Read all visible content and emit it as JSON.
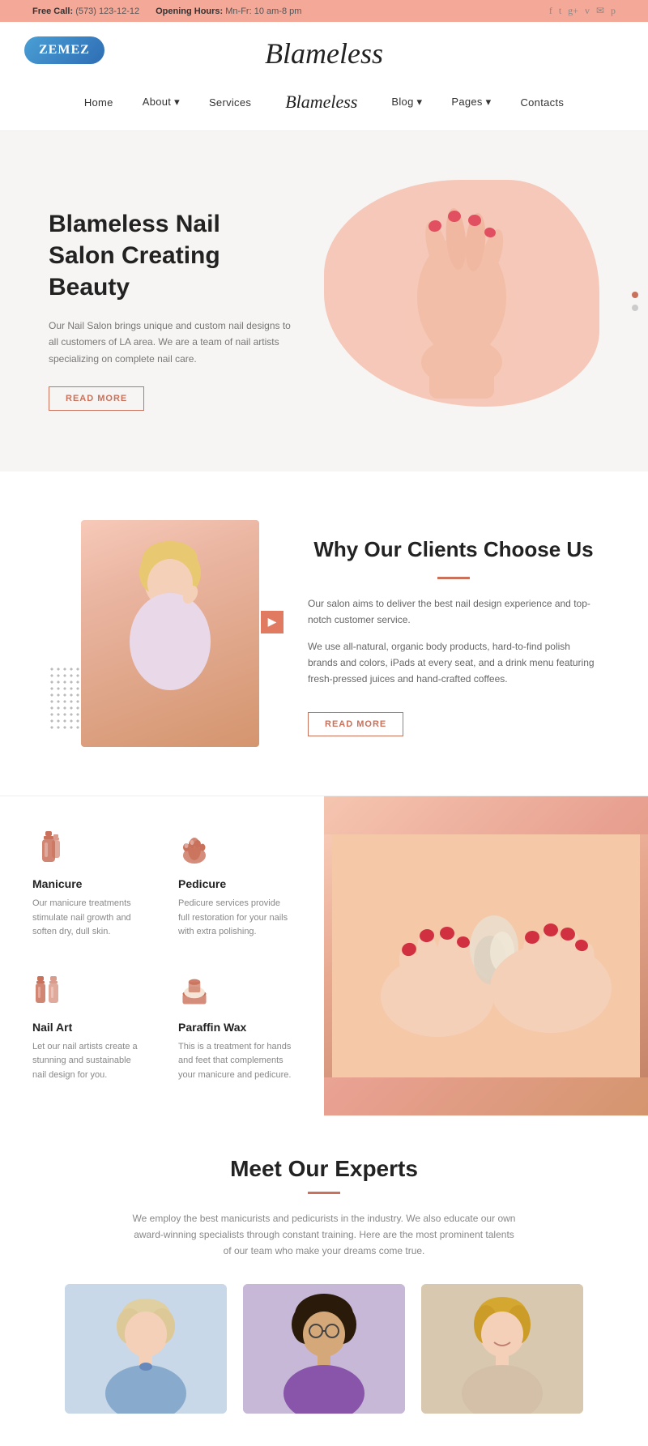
{
  "brand": {
    "zemez": "ZEMEZ",
    "name": "Blameless",
    "logo": "Blameless"
  },
  "topbar": {
    "free_call_label": "Free Call:",
    "free_call_number": "(573) 123-12-12",
    "opening_hours_label": "Opening Hours:",
    "opening_hours_value": "Mn-Fr: 10 am-8 pm"
  },
  "nav": {
    "items": [
      {
        "label": "Home",
        "has_dropdown": false
      },
      {
        "label": "About",
        "has_dropdown": true
      },
      {
        "label": "Services",
        "has_dropdown": false
      },
      {
        "label": "Blog",
        "has_dropdown": true
      },
      {
        "label": "Pages",
        "has_dropdown": true
      },
      {
        "label": "Contacts",
        "has_dropdown": false
      }
    ]
  },
  "hero": {
    "title": "Blameless Nail Salon Creating Beauty",
    "description": "Our Nail Salon brings unique and custom nail designs to all customers of LA area. We are a team of nail artists specializing on complete nail care.",
    "cta": "READ MORE",
    "dots": [
      "active",
      "inactive"
    ]
  },
  "why": {
    "title": "Why Our Clients Choose Us",
    "paragraph1": "Our salon aims to deliver the best nail design experience and top-notch customer service.",
    "paragraph2": "We use all-natural, organic body products, hard-to-find polish brands and colors, iPads at every seat, and a drink menu featuring fresh-pressed juices and hand-crafted coffees.",
    "cta": "READ MORE"
  },
  "services": {
    "items": [
      {
        "title": "Manicure",
        "description": "Our manicure treatments stimulate nail growth and soften dry, dull skin.",
        "icon": "manicure-icon"
      },
      {
        "title": "Pedicure",
        "description": "Pedicure services provide full restoration for your nails with extra polishing.",
        "icon": "pedicure-icon"
      },
      {
        "title": "Nail Art",
        "description": "Let our nail artists create a stunning and sustainable nail design for you.",
        "icon": "nail-art-icon"
      },
      {
        "title": "Paraffin Wax",
        "description": "This is a treatment for hands and feet that complements your manicure and pedicure.",
        "icon": "paraffin-icon"
      }
    ]
  },
  "experts": {
    "title": "Meet Our Experts",
    "subtitle": "We employ the best manicurists and pedicurists in the industry. We also educate our own award-winning specialists through constant training. Here are the most prominent talents of our team who make your dreams come true.",
    "divider_color": "#c9715a"
  },
  "colors": {
    "accent": "#c9715a",
    "light_accent": "#f4a898",
    "text_dark": "#222222",
    "text_muted": "#888888"
  }
}
